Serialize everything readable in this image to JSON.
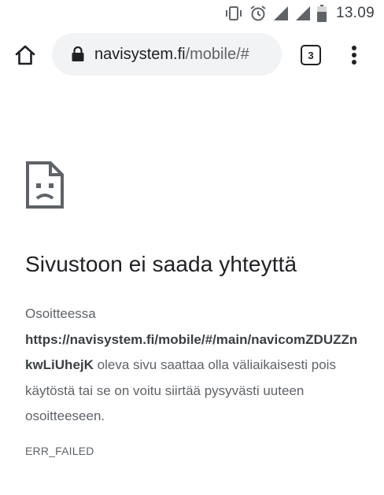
{
  "status_bar": {
    "time": "13.09",
    "icons": [
      "vibrate-icon",
      "alarm-icon",
      "signal-icon",
      "signal-icon",
      "battery-icon"
    ]
  },
  "toolbar": {
    "url_domain": "navisystem.fi",
    "url_path": "/mobile/#",
    "tab_count": "3",
    "icons": [
      "home-icon",
      "lock-icon",
      "more-vert-icon"
    ]
  },
  "error": {
    "icon": "sad-page-icon",
    "title": "Sivustoon ei saada yhteyttä",
    "intro": "Osoitteessa",
    "url": "https://navisystem.fi/mobile/#/main/navicomZDUZZnkwLiUhejK",
    "message": " oleva sivu saattaa olla väliaikaisesti pois käytöstä tai se on voitu siirtää pysyvästi uuteen osoitteeseen.",
    "code": "ERR_FAILED"
  }
}
